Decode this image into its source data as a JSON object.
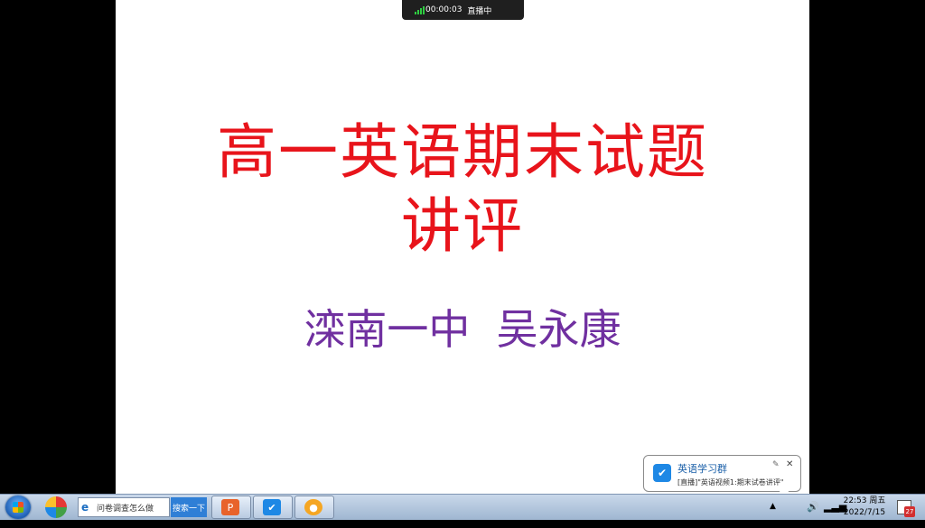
{
  "live_bar": {
    "elapsed": "00:00:03",
    "status": "直播中"
  },
  "slide": {
    "title_line1": "高一英语期末试题",
    "title_line2": "讲评",
    "author": "滦南一中  吴永康"
  },
  "notification": {
    "title": "英语学习群",
    "body": "[直播]\"英语视频1:期末试卷讲评\"",
    "pin_icon": "pin-icon",
    "close_icon": "close-icon"
  },
  "taskbar": {
    "search_text": "问卷调查怎么做",
    "search_button": "搜索一下",
    "clock_time": "22:53 周五",
    "clock_date": "2022/7/15",
    "tray_badge": "27"
  },
  "colors": {
    "title": "#e8141b",
    "author": "#7030a0",
    "accent": "#1e88e5"
  }
}
